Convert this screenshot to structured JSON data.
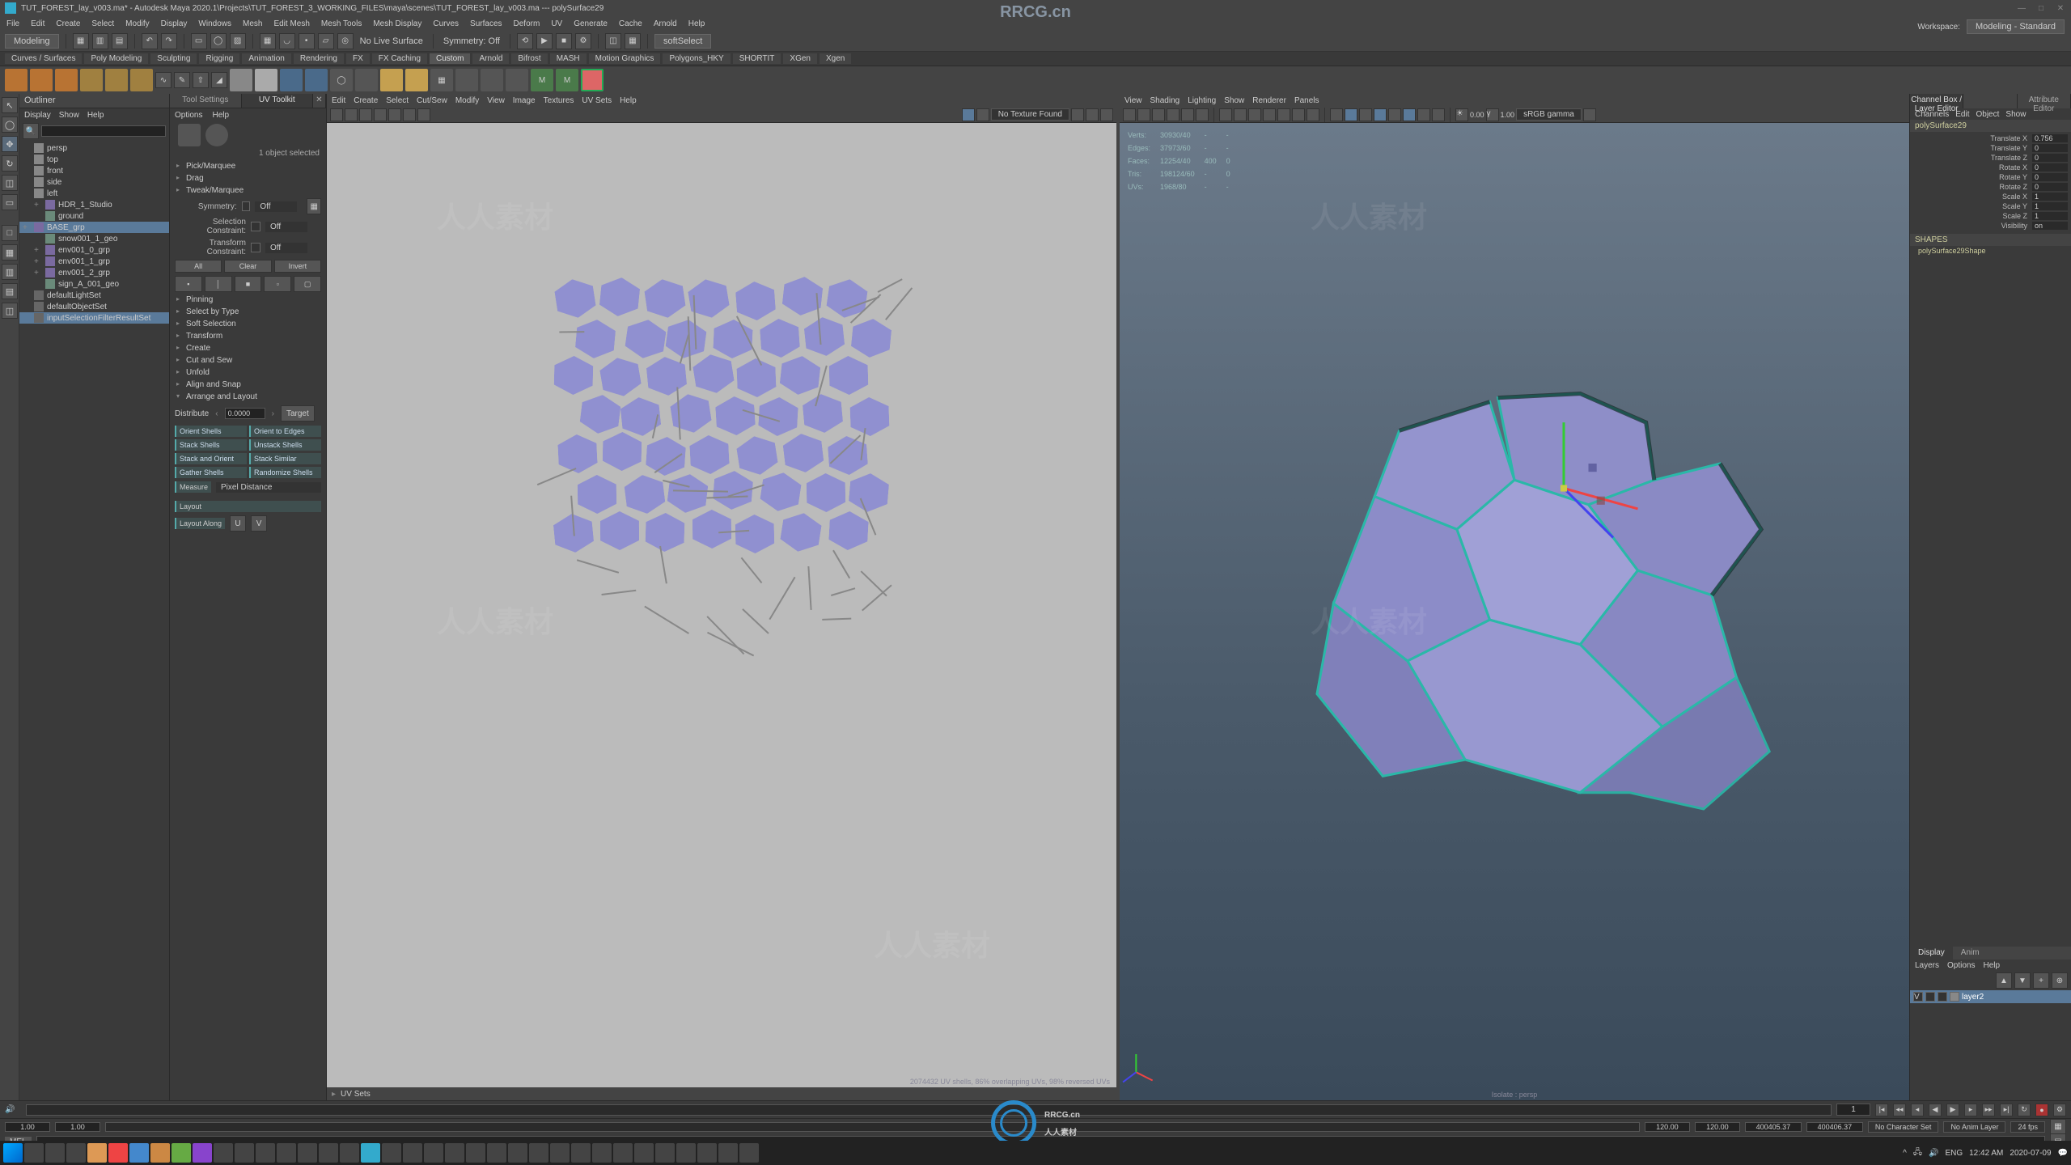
{
  "title": "TUT_FOREST_lay_v003.ma* - Autodesk Maya 2020.1\\Projects\\TUT_FOREST_3_WORKING_FILES\\maya\\scenes\\TUT_FOREST_lay_v003.ma --- polySurface29",
  "watermark_domain": "RRCG.cn",
  "watermark_text": "人人素材",
  "menubar": [
    "File",
    "Edit",
    "Create",
    "Select",
    "Modify",
    "Display",
    "Windows",
    "Mesh",
    "Edit Mesh",
    "Mesh Tools",
    "Mesh Display",
    "Curves",
    "Surfaces",
    "Deform",
    "UV",
    "Generate",
    "Cache",
    "Arnold",
    "Help"
  ],
  "workspace_dd": "Modeling",
  "status_line": {
    "symmetry": "Symmetry: Off",
    "softselect": "softSelect"
  },
  "shelf_tabs": [
    "Curves / Surfaces",
    "Poly Modeling",
    "Sculpting",
    "Rigging",
    "Animation",
    "Rendering",
    "FX",
    "FX Caching",
    "Custom",
    "Arnold",
    "Bifrost",
    "MASH",
    "Motion Graphics",
    "Polygons_HKY",
    "SHORTIT",
    "XGen",
    "Xgen"
  ],
  "shelf_active": "Custom",
  "outliner": {
    "title": "Outliner",
    "menu": [
      "Display",
      "Show",
      "Help"
    ],
    "items": [
      {
        "t": "persp",
        "k": "cam"
      },
      {
        "t": "top",
        "k": "cam"
      },
      {
        "t": "front",
        "k": "cam"
      },
      {
        "t": "side",
        "k": "cam"
      },
      {
        "t": "left",
        "k": "cam"
      },
      {
        "t": "HDR_1_Studio",
        "k": "grp",
        "i": 1
      },
      {
        "t": "ground",
        "k": "mesh",
        "i": 1
      },
      {
        "t": "BASE_grp",
        "k": "grp",
        "sel": true,
        "i": 0
      },
      {
        "t": "snow001_1_geo",
        "k": "mesh",
        "i": 1
      },
      {
        "t": "env001_0_grp",
        "k": "grp",
        "i": 1
      },
      {
        "t": "env001_1_grp",
        "k": "grp",
        "i": 1
      },
      {
        "t": "env001_2_grp",
        "k": "grp",
        "i": 1
      },
      {
        "t": "sign_A_001_geo",
        "k": "mesh",
        "i": 1
      },
      {
        "t": "defaultLightSet",
        "k": "set",
        "i": 0
      },
      {
        "t": "defaultObjectSet",
        "k": "set",
        "i": 0
      },
      {
        "t": "inputSelectionFilterResultSet",
        "k": "set",
        "sel": true,
        "i": 0
      }
    ]
  },
  "toolkit": {
    "tabs": [
      "Tool Settings",
      "UV Toolkit"
    ],
    "active": "UV Toolkit",
    "menu": [
      "Options",
      "Help"
    ],
    "status": "1 object selected",
    "brush_items": [
      "Pick/Marquee",
      "Drag",
      "Tweak/Marquee"
    ],
    "symmetry": {
      "label": "Symmetry:",
      "value": "Off"
    },
    "sel_constraint": {
      "label": "Selection Constraint:",
      "value": "Off"
    },
    "trans_constraint": {
      "label": "Transform Constraint:",
      "value": "Off"
    },
    "all_clear_invert": [
      "All",
      "Clear",
      "Invert"
    ],
    "sections": [
      "Pinning",
      "Select by Type",
      "Soft Selection",
      "Transform",
      "Create",
      "Cut and Sew",
      "Unfold",
      "Align and Snap",
      "Arrange and Layout"
    ],
    "open_section": "Arrange and Layout",
    "distribute": {
      "label": "Distribute",
      "value": "0.0000",
      "target": "Target"
    },
    "grid": [
      [
        "Orient Shells",
        "Orient to Edges"
      ],
      [
        "Stack Shells",
        "Unstack Shells"
      ],
      [
        "Stack and Orient",
        "Stack Similar"
      ],
      [
        "Gather Shells",
        "Randomize Shells"
      ]
    ],
    "measure": {
      "label": "Measure",
      "value": "Pixel Distance"
    },
    "layout": [
      "Layout",
      "Layout Along"
    ]
  },
  "uvview": {
    "menu": [
      "Edit",
      "Create",
      "Select",
      "Cut/Sew",
      "Modify",
      "View",
      "Image",
      "Textures",
      "UV Sets",
      "Help"
    ],
    "toolbar_r_dd": "No Texture Found",
    "footer": "2074432 UV shells, 86% overlapping UVs, 98% reversed UVs",
    "uvsets_label": "UV Sets"
  },
  "pview": {
    "menu": [
      "View",
      "Shading",
      "Lighting",
      "Show",
      "Renderer",
      "Panels"
    ],
    "toolbar_dd": "sRGB gamma",
    "gamma": "1.00",
    "exposure": "0.00",
    "hud": {
      "headers": [
        "",
        "",
        "",
        ""
      ],
      "rows": [
        [
          "Verts:",
          "30930/40",
          "-",
          "-"
        ],
        [
          "Edges:",
          "37973/60",
          "-",
          "-"
        ],
        [
          "Faces:",
          "12254/40",
          "400",
          "0"
        ],
        [
          "Tris:",
          "198124/60",
          "-",
          "0"
        ],
        [
          "UVs:",
          "1968/80",
          "-",
          "-"
        ]
      ]
    },
    "isolate": "Isolate : persp"
  },
  "channelbox": {
    "tabs": [
      "Channel Box / Layer Editor",
      "",
      "Attribute Editor"
    ],
    "menu": [
      "Channels",
      "Edit",
      "Object",
      "Show"
    ],
    "object": "polySurface29",
    "attrs": [
      [
        "Translate X",
        "0.756"
      ],
      [
        "Translate Y",
        "0"
      ],
      [
        "Translate Z",
        "0"
      ],
      [
        "Rotate X",
        "0"
      ],
      [
        "Rotate Y",
        "0"
      ],
      [
        "Rotate Z",
        "0"
      ],
      [
        "Scale X",
        "1"
      ],
      [
        "Scale Y",
        "1"
      ],
      [
        "Scale Z",
        "1"
      ],
      [
        "Visibility",
        "on"
      ]
    ],
    "shapes_label": "SHAPES",
    "shape": "polySurface29Shape"
  },
  "layers": {
    "tabs": [
      "Display",
      "Anim"
    ],
    "menu": [
      "Layers",
      "Options",
      "Help"
    ],
    "layer": "layer2"
  },
  "time": {
    "cur": "1",
    "start": "1.00",
    "end": "120.00",
    "range_start": "400405.37",
    "range_end": "400406.37",
    "nochar": "No Character Set",
    "nolayer": "No Anim Layer",
    "fps": "24 fps"
  },
  "helpline": "",
  "cmd_prefix": "MEL",
  "topright": {
    "workspace": "Workspace:",
    "mode": "Modeling - Standard"
  },
  "taskbar": {
    "time": "12:42 AM",
    "date": "2020-07-09"
  }
}
